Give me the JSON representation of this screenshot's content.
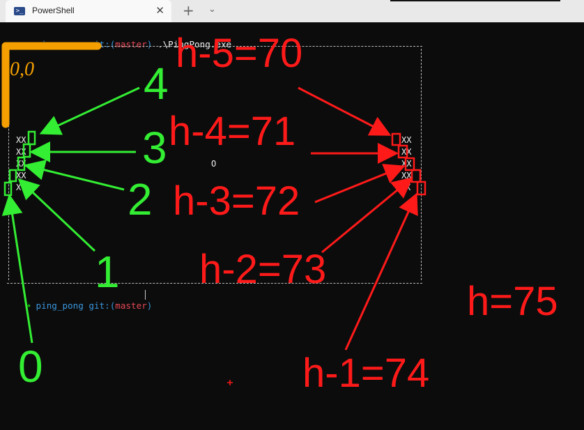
{
  "window": {
    "tab_icon": "powershell-icon",
    "tab_title": "PowerShell",
    "close_glyph": "✕",
    "new_tab_glyph": "+",
    "dropdown_glyph": "⌄"
  },
  "terminal": {
    "prompt1": {
      "arrow": "➜",
      "dir": "ping_pong",
      "git_prefix": "git:(",
      "branch": "master",
      "git_suffix": ")",
      "command": ".\\PingPong.exe"
    },
    "prompt2": {
      "arrow": "➜",
      "dir": "ping_pong",
      "git_prefix": "git:(",
      "branch": "master",
      "git_suffix": ")"
    },
    "left_paddle": [
      "XX",
      "XX",
      "XX",
      "XX",
      "X"
    ],
    "right_paddle": [
      "XX",
      "XX",
      "XX",
      "XX",
      "X"
    ],
    "ball": "O"
  },
  "annotations": {
    "origin": "0,0",
    "left_labels": [
      "4",
      "3",
      "2",
      "1",
      "0"
    ],
    "right_labels": [
      "h-5=70",
      "h-4=71",
      "h-3=72",
      "h-2=73",
      "h-1=74"
    ],
    "height_label": "h=75",
    "colors": {
      "green": "#33ee33",
      "red": "#ff1a1a",
      "orange": "#f5a000"
    }
  }
}
